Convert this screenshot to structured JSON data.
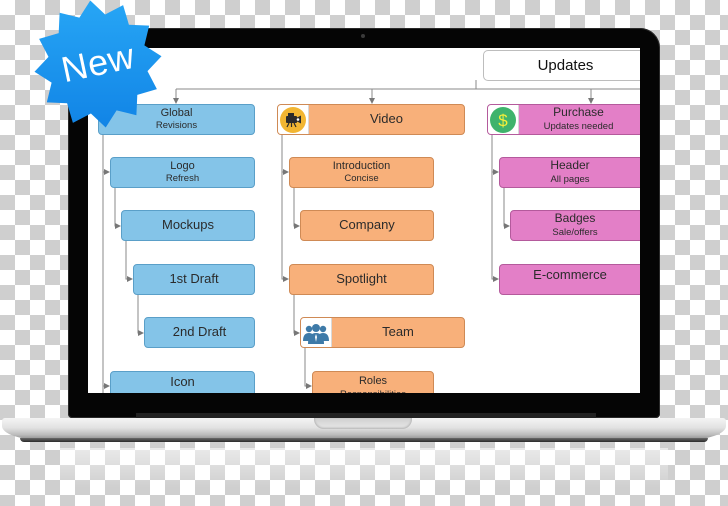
{
  "badge": {
    "label": "New",
    "color": "#1e9bf0"
  },
  "diagram": {
    "root": {
      "title": "Updates"
    },
    "columns": [
      {
        "color": "blue",
        "head": {
          "title": "Global",
          "subtitle": "Revisions"
        },
        "items": [
          {
            "title": "Logo",
            "subtitle": "Refresh"
          },
          {
            "title": "Mockups"
          },
          {
            "title": "1st Draft"
          },
          {
            "title": "2nd Draft"
          },
          {
            "title": "Icon"
          }
        ]
      },
      {
        "color": "orange",
        "head": {
          "title": "Video",
          "icon": "video-camera-icon"
        },
        "items": [
          {
            "title": "Introduction",
            "subtitle": "Concise"
          },
          {
            "title": "Company"
          },
          {
            "title": "Spotlight"
          },
          {
            "title": "Team",
            "icon": "team-people-icon"
          },
          {
            "title": "Roles",
            "subtitle": "Responsibilities"
          }
        ]
      },
      {
        "color": "pink",
        "head": {
          "title": "Purchase",
          "subtitle": "Updates needed",
          "icon": "dollar-icon"
        },
        "items": [
          {
            "title": "Header",
            "subtitle": "All pages"
          },
          {
            "title": "Badges",
            "subtitle": "Sale/offers"
          },
          {
            "title": "E-commerce"
          }
        ]
      }
    ]
  },
  "colors": {
    "blue": "#84c4e8",
    "orange": "#f8b07a",
    "pink": "#e37fc7",
    "video_icon_bg": "#f2b632",
    "dollar_icon_bg": "#3fb36c",
    "team_icon": "#3e7aa8"
  }
}
